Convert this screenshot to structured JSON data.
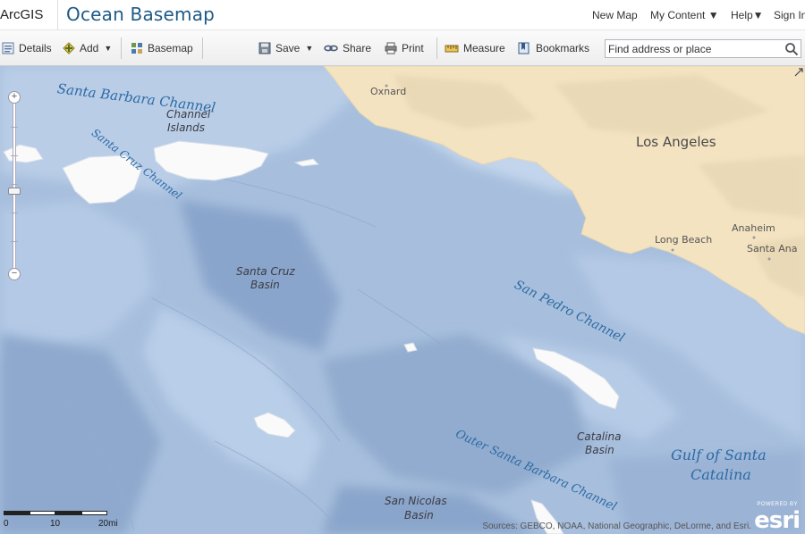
{
  "header": {
    "brand": "ArcGIS",
    "title": "Ocean Basemap",
    "nav": {
      "new_map": "New Map",
      "my_content": "My Content ▼",
      "help": "Help▼",
      "sign_in": "Sign In"
    }
  },
  "toolbar": {
    "details": "Details",
    "add": "Add",
    "basemap": "Basemap",
    "save": "Save",
    "share": "Share",
    "print": "Print",
    "measure": "Measure",
    "bookmarks": "Bookmarks",
    "search_placeholder": "Find address or place"
  },
  "map": {
    "water_labels": {
      "santa_barbara_channel": "Santa Barbara Channel",
      "santa_cruz_channel": "Santa Cruz Channel",
      "san_pedro_channel": "San Pedro Channel",
      "outer_santa_barbara_channel": "Outer Santa Barbara Channel",
      "gulf_line1": "Gulf of Santa",
      "gulf_line2": "Catalina"
    },
    "basin_labels": {
      "channel_islands_1": "Channel",
      "channel_islands_2": "Islands",
      "santa_cruz_1": "Santa Cruz",
      "santa_cruz_2": "Basin",
      "catalina_1": "Catalina",
      "catalina_2": "Basin",
      "san_nicolas_1": "San Nicolas",
      "san_nicolas_2": "Basin"
    },
    "cities": {
      "oxnard": "Oxnard",
      "los_angeles": "Los Angeles",
      "long_beach": "Long Beach",
      "anaheim": "Anaheim",
      "santa_ana": "Santa Ana"
    },
    "scale": {
      "zero": "0",
      "mid": "10",
      "end": "20mi"
    },
    "attribution": "Sources: GEBCO, NOAA, National Geographic, DeLorme, and Esri.",
    "esri": {
      "powered": "POWERED BY",
      "word": "esri"
    },
    "colors": {
      "land": "#f3e3c1",
      "deep_water": "#7f9cc6",
      "shelf_water": "#b5cbe6",
      "island": "#ffffff",
      "water_label": "#2c6aa4"
    }
  }
}
